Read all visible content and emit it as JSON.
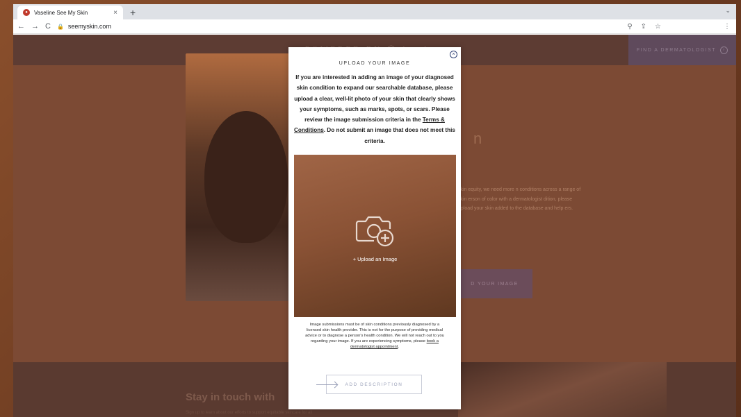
{
  "browser": {
    "tab_title": "Vaseline See My Skin",
    "tab_close": "×",
    "new_tab": "+",
    "url": "seemyskin.com",
    "nav_back": "←",
    "nav_forward": "→",
    "reload": "C",
    "tab_menu": "⌄",
    "zoom_icon": "⚲",
    "share_icon": "⇪",
    "star_icon": "☆",
    "menu_icon": "⋮"
  },
  "site": {
    "header_logo": "POWERED BY  ◯  hued",
    "find_dermatologist": "FIND A DERMATOLOGIST",
    "hero_heading": "n",
    "hero_text": "skin equity, we need more n conditions across a range of skin erson of color with a dermatologist dition, please upload your skin added to the database and help ers.",
    "hero_button": "D YOUR IMAGE",
    "stay_in_touch": "Stay in touch with",
    "stay_sub": "Sign up to learn about our efforts to support equitable skincare for all"
  },
  "modal": {
    "title": "UPLOAD YOUR IMAGE",
    "close_icon": "×",
    "intro_before_link": "If you are interested in adding an image of your diagnosed skin condition to expand our searchable database, please upload a clear, well-lit photo of your skin that clearly shows your symptoms, such as marks, spots, or scars. Please review the image submission criteria in the ",
    "terms_link": "Terms & Conditions",
    "intro_after_link": ". Do not submit an image that does not meet this criteria.",
    "upload_label": "+ Upload an Image",
    "disclaimer_before_link": "Image submissions must be of skin conditions previously diagnosed by a licensed skin health provider. This is not for the purpose of providing medical advice or to diagnose a person's health condition. We will not reach out to you regarding your image. If you are experiencing symptoms, please ",
    "disclaimer_link": "book a dermatologist appointment",
    "disclaimer_after_link": ".",
    "add_description": "ADD DESCRIPTION"
  },
  "colors": {
    "modal_close": "#2c3e73",
    "upload_gradient_start": "#a06546",
    "upload_gradient_end": "#5f3820"
  }
}
